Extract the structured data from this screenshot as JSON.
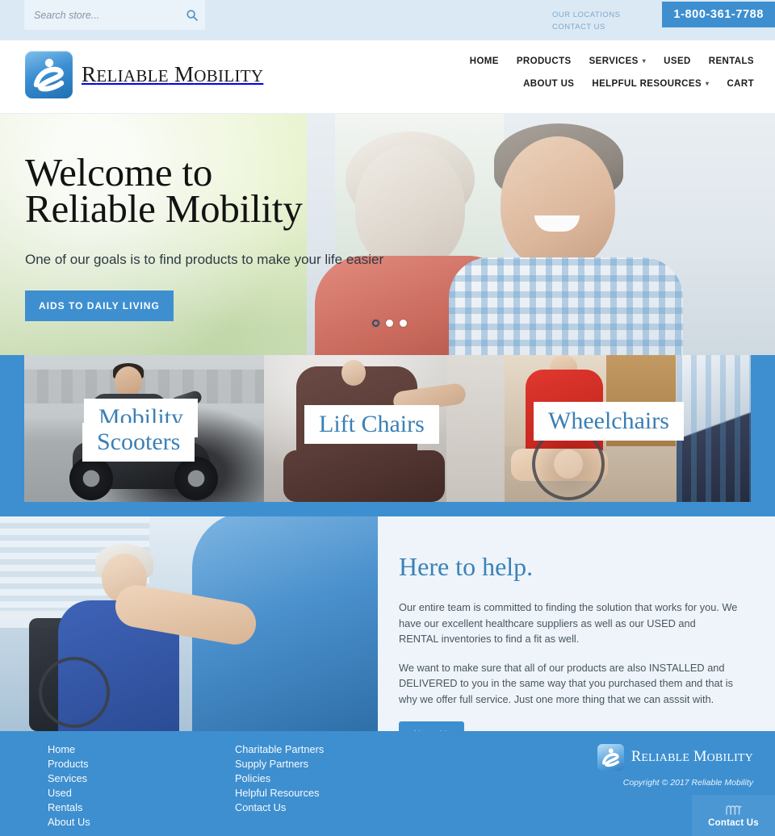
{
  "colors": {
    "brand_blue": "#3d8fd0",
    "utility_bar_bg": "#dbe9f5",
    "link_blue": "#3b7fb5",
    "help_bg": "#eef4fa"
  },
  "utility": {
    "search_placeholder": "Search store...",
    "search_value": "",
    "search_icon": "search-icon",
    "links": [
      {
        "label": "Our Locations"
      },
      {
        "label": "Contact Us"
      }
    ],
    "phone": "1-800-361-7788"
  },
  "header": {
    "brand": "Reliable Mobility",
    "logo_icon": "reliable-mobility-logo-icon",
    "nav": [
      {
        "label": "Home",
        "caret": false
      },
      {
        "label": "Products",
        "caret": false
      },
      {
        "label": "Services",
        "caret": true
      },
      {
        "label": "Used",
        "caret": false
      },
      {
        "label": "Rentals",
        "caret": false
      },
      {
        "label": "About Us",
        "caret": false
      },
      {
        "label": "Helpful Resources",
        "caret": true
      },
      {
        "label": "Cart",
        "caret": false
      }
    ]
  },
  "hero": {
    "title_line1": "Welcome to",
    "title_line2": "Reliable Mobility",
    "subtitle": "One of our goals is to find products to make your life easier",
    "cta_label": "Aids to Daily Living",
    "slides_total": 3,
    "active_slide": 1
  },
  "categories": [
    {
      "label_line1": "Mobility",
      "label_line2": "Scooters",
      "name": "mobility-scooters"
    },
    {
      "label_line1": "Lift Chairs",
      "label_line2": "",
      "name": "lift-chairs"
    },
    {
      "label_line1": "Wheelchairs",
      "label_line2": "",
      "name": "wheelchairs"
    }
  ],
  "help": {
    "title": "Here to help.",
    "paragraph1": "Our entire team is committed to finding the solution that works for you. We have our excellent healthcare suppliers as well as our USED and RENTAL inventories to find a fit as well.",
    "paragraph2": "We want to make sure that all of our products are also INSTALLED and DELIVERED to you in the same way that you purchased them and that is why we offer full service. Just one more thing that we can asssit with.",
    "cta_label": "About Us"
  },
  "footer": {
    "column1": [
      {
        "label": "Home"
      },
      {
        "label": "Products"
      },
      {
        "label": "Services"
      },
      {
        "label": "Used"
      },
      {
        "label": "Rentals"
      },
      {
        "label": "About Us"
      }
    ],
    "column2": [
      {
        "label": "Charitable Partners"
      },
      {
        "label": "Supply Partners"
      },
      {
        "label": "Policies"
      },
      {
        "label": "Helpful Resources"
      },
      {
        "label": "Contact Us"
      }
    ],
    "brand": "Reliable Mobility",
    "logo_icon": "reliable-mobility-logo-icon",
    "copyright": "Copyright © 2017 Reliable Mobility",
    "contact_widget": {
      "label": "Contact Us",
      "icon": "chat-wave-icon"
    }
  }
}
